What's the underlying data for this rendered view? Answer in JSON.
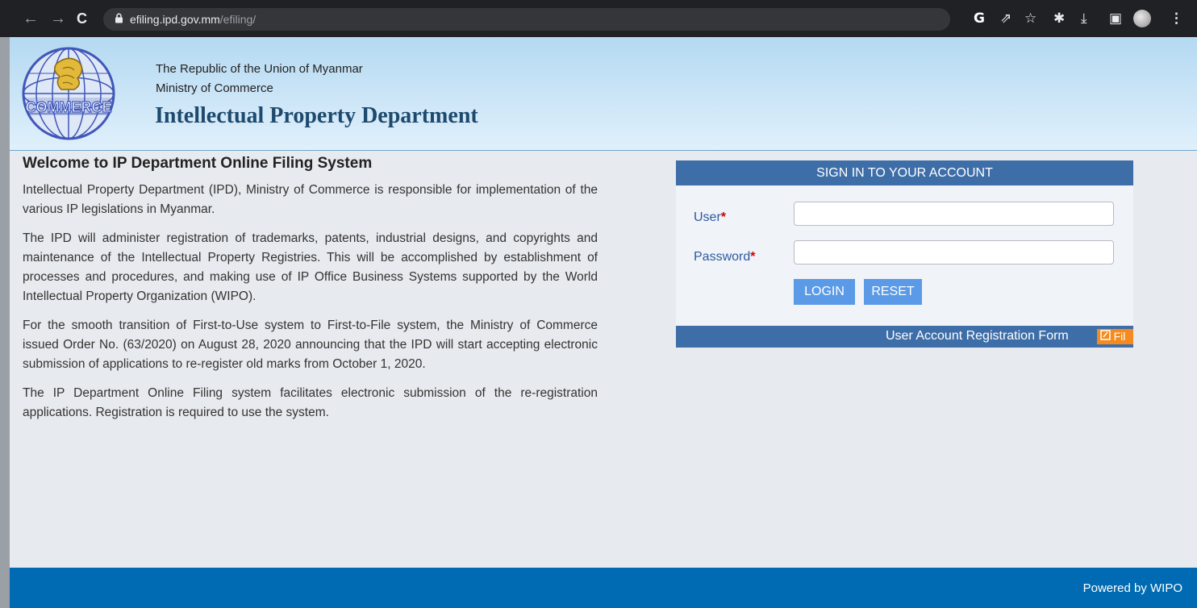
{
  "browser": {
    "back_icon": "←",
    "forward_icon": "→",
    "reload_icon": "C",
    "lock_icon": "🔒",
    "url_host": "efiling.ipd.gov.mm",
    "url_path": "/efiling/",
    "icons": {
      "google": "G",
      "share": "⇗",
      "bookmark": "☆",
      "extensions": "✱",
      "download": "⤓",
      "side_panel": "▣",
      "menu": "⋮"
    }
  },
  "header": {
    "line1": "The Republic of the Union of Myanmar",
    "line2": "Ministry of Commerce",
    "title": "Intellectual Property Department",
    "logo_text": "COMMERCE"
  },
  "main": {
    "welcome_title": "Welcome to IP Department Online Filing System",
    "paragraphs": [
      "Intellectual Property Department (IPD), Ministry of Commerce is responsible for implementation of the various IP legislations in Myanmar.",
      "The IPD will administer registration of trademarks, patents, industrial designs, and copyrights and maintenance of the Intellectual Property Registries. This will be accomplished by establishment of processes and procedures, and making use of IP Office Business Systems supported by the World Intellectual Property Organization (WIPO).",
      "For the smooth transition of First-to-Use system to First-to-File system, the Ministry of Commerce issued Order No. (63/2020) on August 28, 2020 announcing that the IPD will start accepting electronic submission of applications to re-register old marks from October 1, 2020.",
      "The IP Department Online Filing system facilitates electronic submission of the re-registration applications. Registration is required to use the system."
    ]
  },
  "signin": {
    "title": "SIGN IN TO YOUR ACCOUNT",
    "user_label": "User",
    "password_label": "Password",
    "required_mark": "*",
    "user_value": "",
    "password_value": "",
    "login_label": "LOGIN",
    "reset_label": "RESET",
    "registration_label": "User Account Registration Form",
    "registration_badge": "Fil"
  },
  "footer": {
    "text": "Powered by WIPO"
  },
  "colors": {
    "header_blue": "#3e6ea8",
    "button_blue": "#5a9ae6",
    "footer_blue": "#006bb2",
    "badge_orange": "#f58a1f",
    "required_red": "#d40000"
  }
}
